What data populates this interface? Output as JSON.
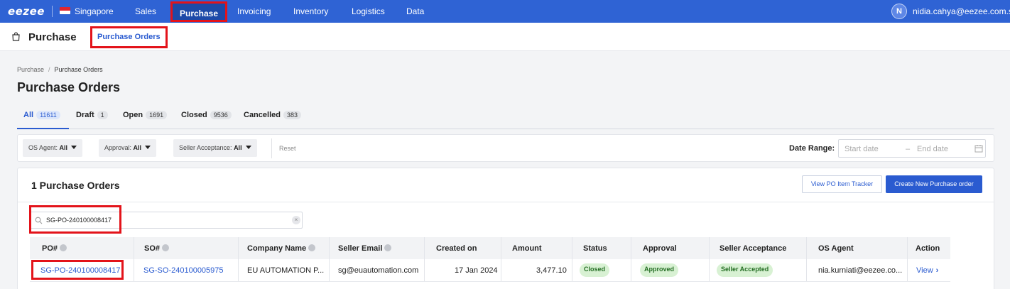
{
  "topbar": {
    "logo": "eezee",
    "country": "Singapore",
    "nav": [
      "Sales",
      "Purchase",
      "Invoicing",
      "Inventory",
      "Logistics",
      "Data"
    ],
    "active_nav": "Purchase",
    "user_initial": "N",
    "user_email": "nidia.cahya@eezee.com.sg"
  },
  "subheader": {
    "title": "Purchase",
    "tab": "Purchase Orders"
  },
  "breadcrumb": {
    "root": "Purchase",
    "separator": "/",
    "current": "Purchase Orders"
  },
  "page_title": "Purchase Orders",
  "status_tabs": [
    {
      "label": "All",
      "count": "11611"
    },
    {
      "label": "Draft",
      "count": "1"
    },
    {
      "label": "Open",
      "count": "1691"
    },
    {
      "label": "Closed",
      "count": "9536"
    },
    {
      "label": "Cancelled",
      "count": "383"
    }
  ],
  "filters": {
    "os_agent": {
      "label": "OS Agent:",
      "value": "All"
    },
    "approval": {
      "label": "Approval:",
      "value": "All"
    },
    "seller_acceptance": {
      "label": "Seller Acceptance:",
      "value": "All"
    },
    "reset": "Reset",
    "date_range_label": "Date Range:",
    "start_placeholder": "Start date",
    "range_dash": "–",
    "end_placeholder": "End date"
  },
  "card": {
    "title": "1 Purchase Orders",
    "btn_tracker": "View PO Item Tracker",
    "btn_create": "Create New Purchase order",
    "search_value": "SG-PO-240100008417",
    "clear_glyph": "×"
  },
  "table": {
    "headers": [
      "PO#",
      "SO#",
      "Company Name",
      "Seller Email",
      "Created on",
      "Amount",
      "Status",
      "Approval",
      "Seller Acceptance",
      "OS Agent",
      "Action"
    ],
    "rows": [
      {
        "po": "SG-PO-240100008417",
        "so": "SG-SO-240100005975",
        "company": "EU AUTOMATION P...",
        "email": "sg@euautomation.com",
        "created": "17 Jan 2024",
        "amount": "3,477.10",
        "status": "Closed",
        "approval": "Approved",
        "seller_acceptance": "Seller Accepted",
        "os_agent": "nia.kurniati@eezee.co...",
        "action": "View",
        "action_glyph": "›"
      }
    ]
  },
  "colors": {
    "brand": "#2f63d4",
    "link": "#2a5bd0",
    "highlight": "#e3131a",
    "success_bg": "#d8f1d3",
    "success_fg": "#236d22"
  }
}
